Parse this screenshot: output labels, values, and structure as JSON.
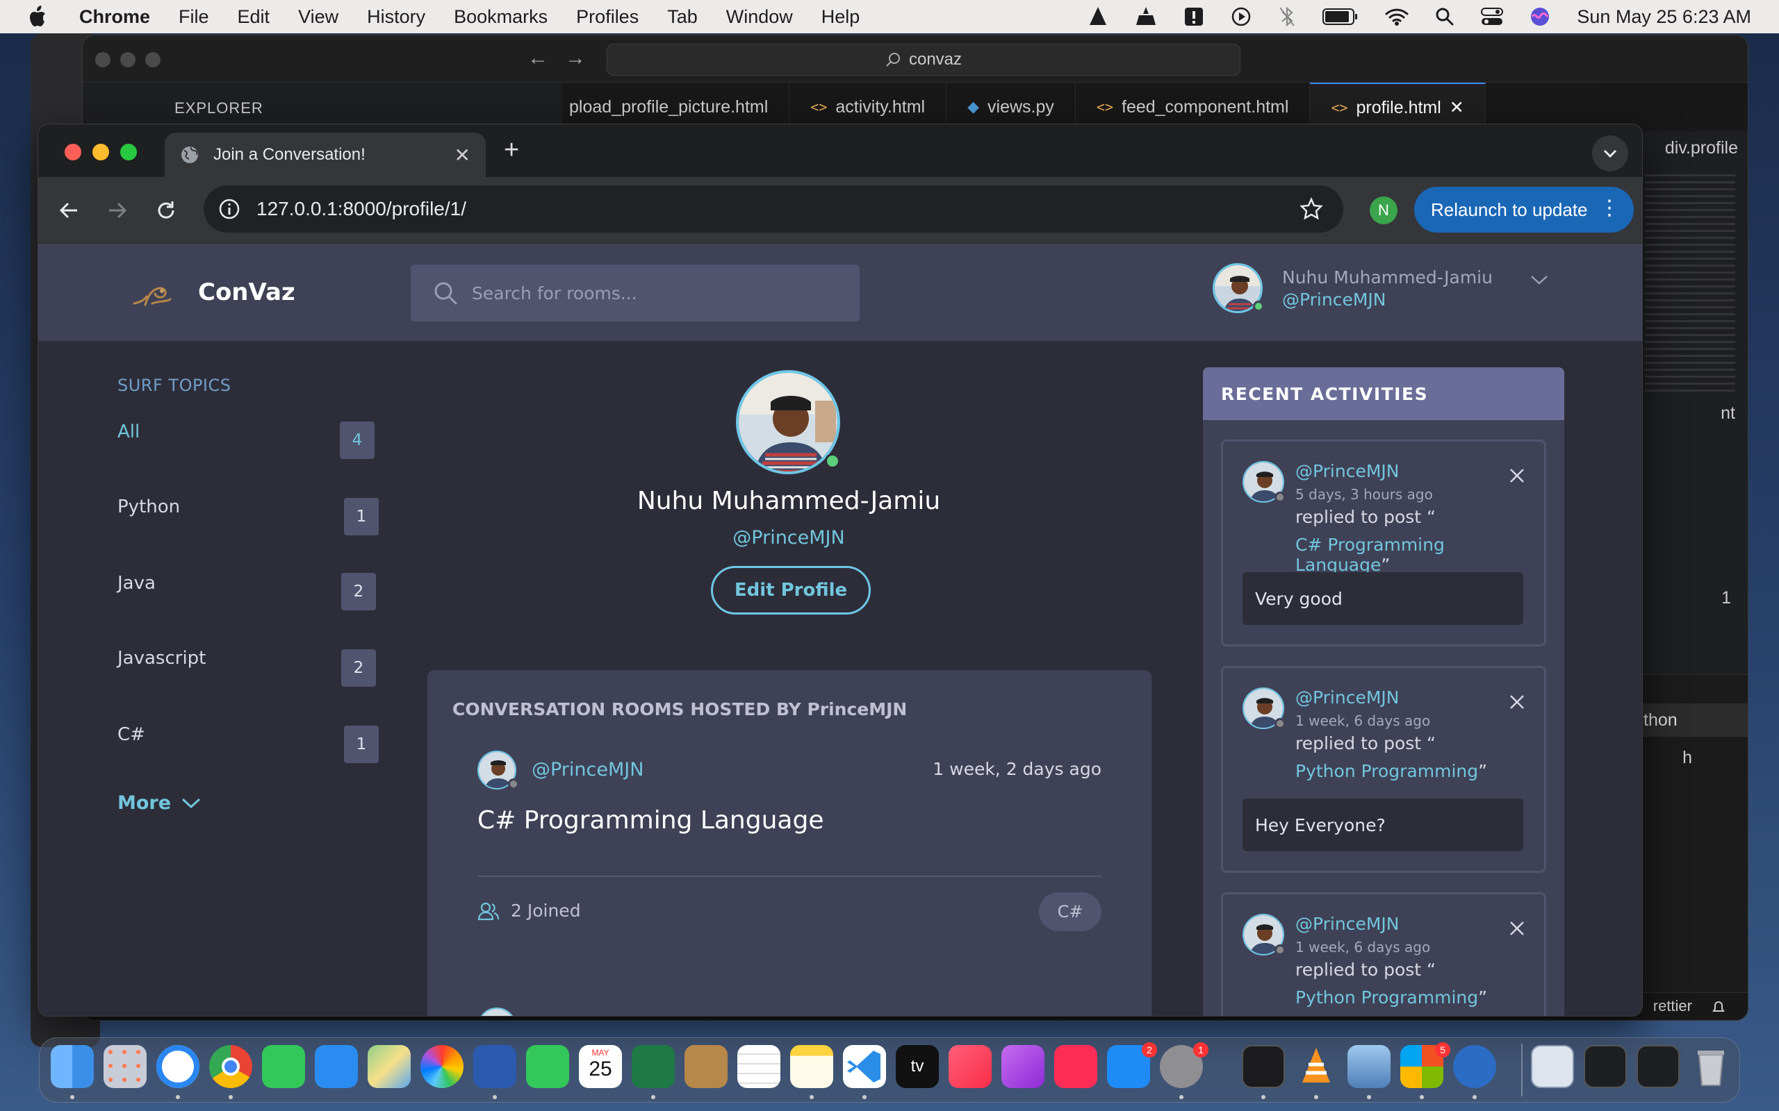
{
  "menubar": {
    "app": "Chrome",
    "items": [
      "File",
      "Edit",
      "View",
      "History",
      "Bookmarks",
      "Profiles",
      "Tab",
      "Window",
      "Help"
    ],
    "clock": "Sun May 25  6:23 AM"
  },
  "vscode": {
    "search": "convaz",
    "explorer": "EXPLORER",
    "tabs": [
      "pload_profile_picture.html",
      "activity.html",
      "views.py",
      "feed_component.html",
      "profile.html"
    ],
    "breadcrumb": "div.profile",
    "panel_row": "thon",
    "panel_row2": "h",
    "status_right": "rettier",
    "side_edge_1": "nt",
    "side_edge_2": "1"
  },
  "browser": {
    "tab_title": "Join a Conversation!",
    "url": "127.0.0.1:8000/profile/1/",
    "profile_initial": "N",
    "relaunch": "Relaunch to update"
  },
  "header": {
    "brand": "ConVaz",
    "search_placeholder": "Search for rooms...",
    "user_name": "Nuhu Muhammed-Jamiu",
    "user_handle": "@PrinceMJN"
  },
  "sidebar": {
    "title": "SURF TOPICS",
    "topics": [
      {
        "label": "All",
        "count": "4"
      },
      {
        "label": "Python",
        "count": "1"
      },
      {
        "label": "Java",
        "count": "2"
      },
      {
        "label": "Javascript",
        "count": "2"
      },
      {
        "label": "C#",
        "count": "1"
      }
    ],
    "more": "More"
  },
  "profile": {
    "name": "Nuhu Muhammed-Jamiu",
    "handle": "@PrinceMJN",
    "edit_button": "Edit Profile"
  },
  "rooms": {
    "heading": "CONVERSATION ROOMS HOSTED BY PrinceMJN",
    "items": [
      {
        "host": "@PrinceMJN",
        "time": "1 week, 2 days ago",
        "title": "C# Programming Language",
        "joined": "2 Joined",
        "tag": "C#"
      }
    ]
  },
  "activities": {
    "heading": "RECENT ACTIVITIES",
    "items": [
      {
        "handle": "@PrinceMJN",
        "ago": "5 days, 3 hours ago",
        "verb": "replied to post “",
        "post": "C# Programming Language",
        "close_quote": "”",
        "message": "Very good"
      },
      {
        "handle": "@PrinceMJN",
        "ago": "1 week, 6 days ago",
        "verb": "replied to post “",
        "post": "Python Programming",
        "close_quote": "”",
        "message": "Hey Everyone?"
      },
      {
        "handle": "@PrinceMJN",
        "ago": "1 week, 6 days ago",
        "verb": "replied to post “",
        "post": "Python Programming",
        "close_quote": "”",
        "message": ""
      }
    ]
  },
  "dock": {
    "calendar_month": "MAY",
    "calendar_day": "25",
    "badges": [
      "2",
      "1",
      "5"
    ],
    "appletv": "tv"
  }
}
